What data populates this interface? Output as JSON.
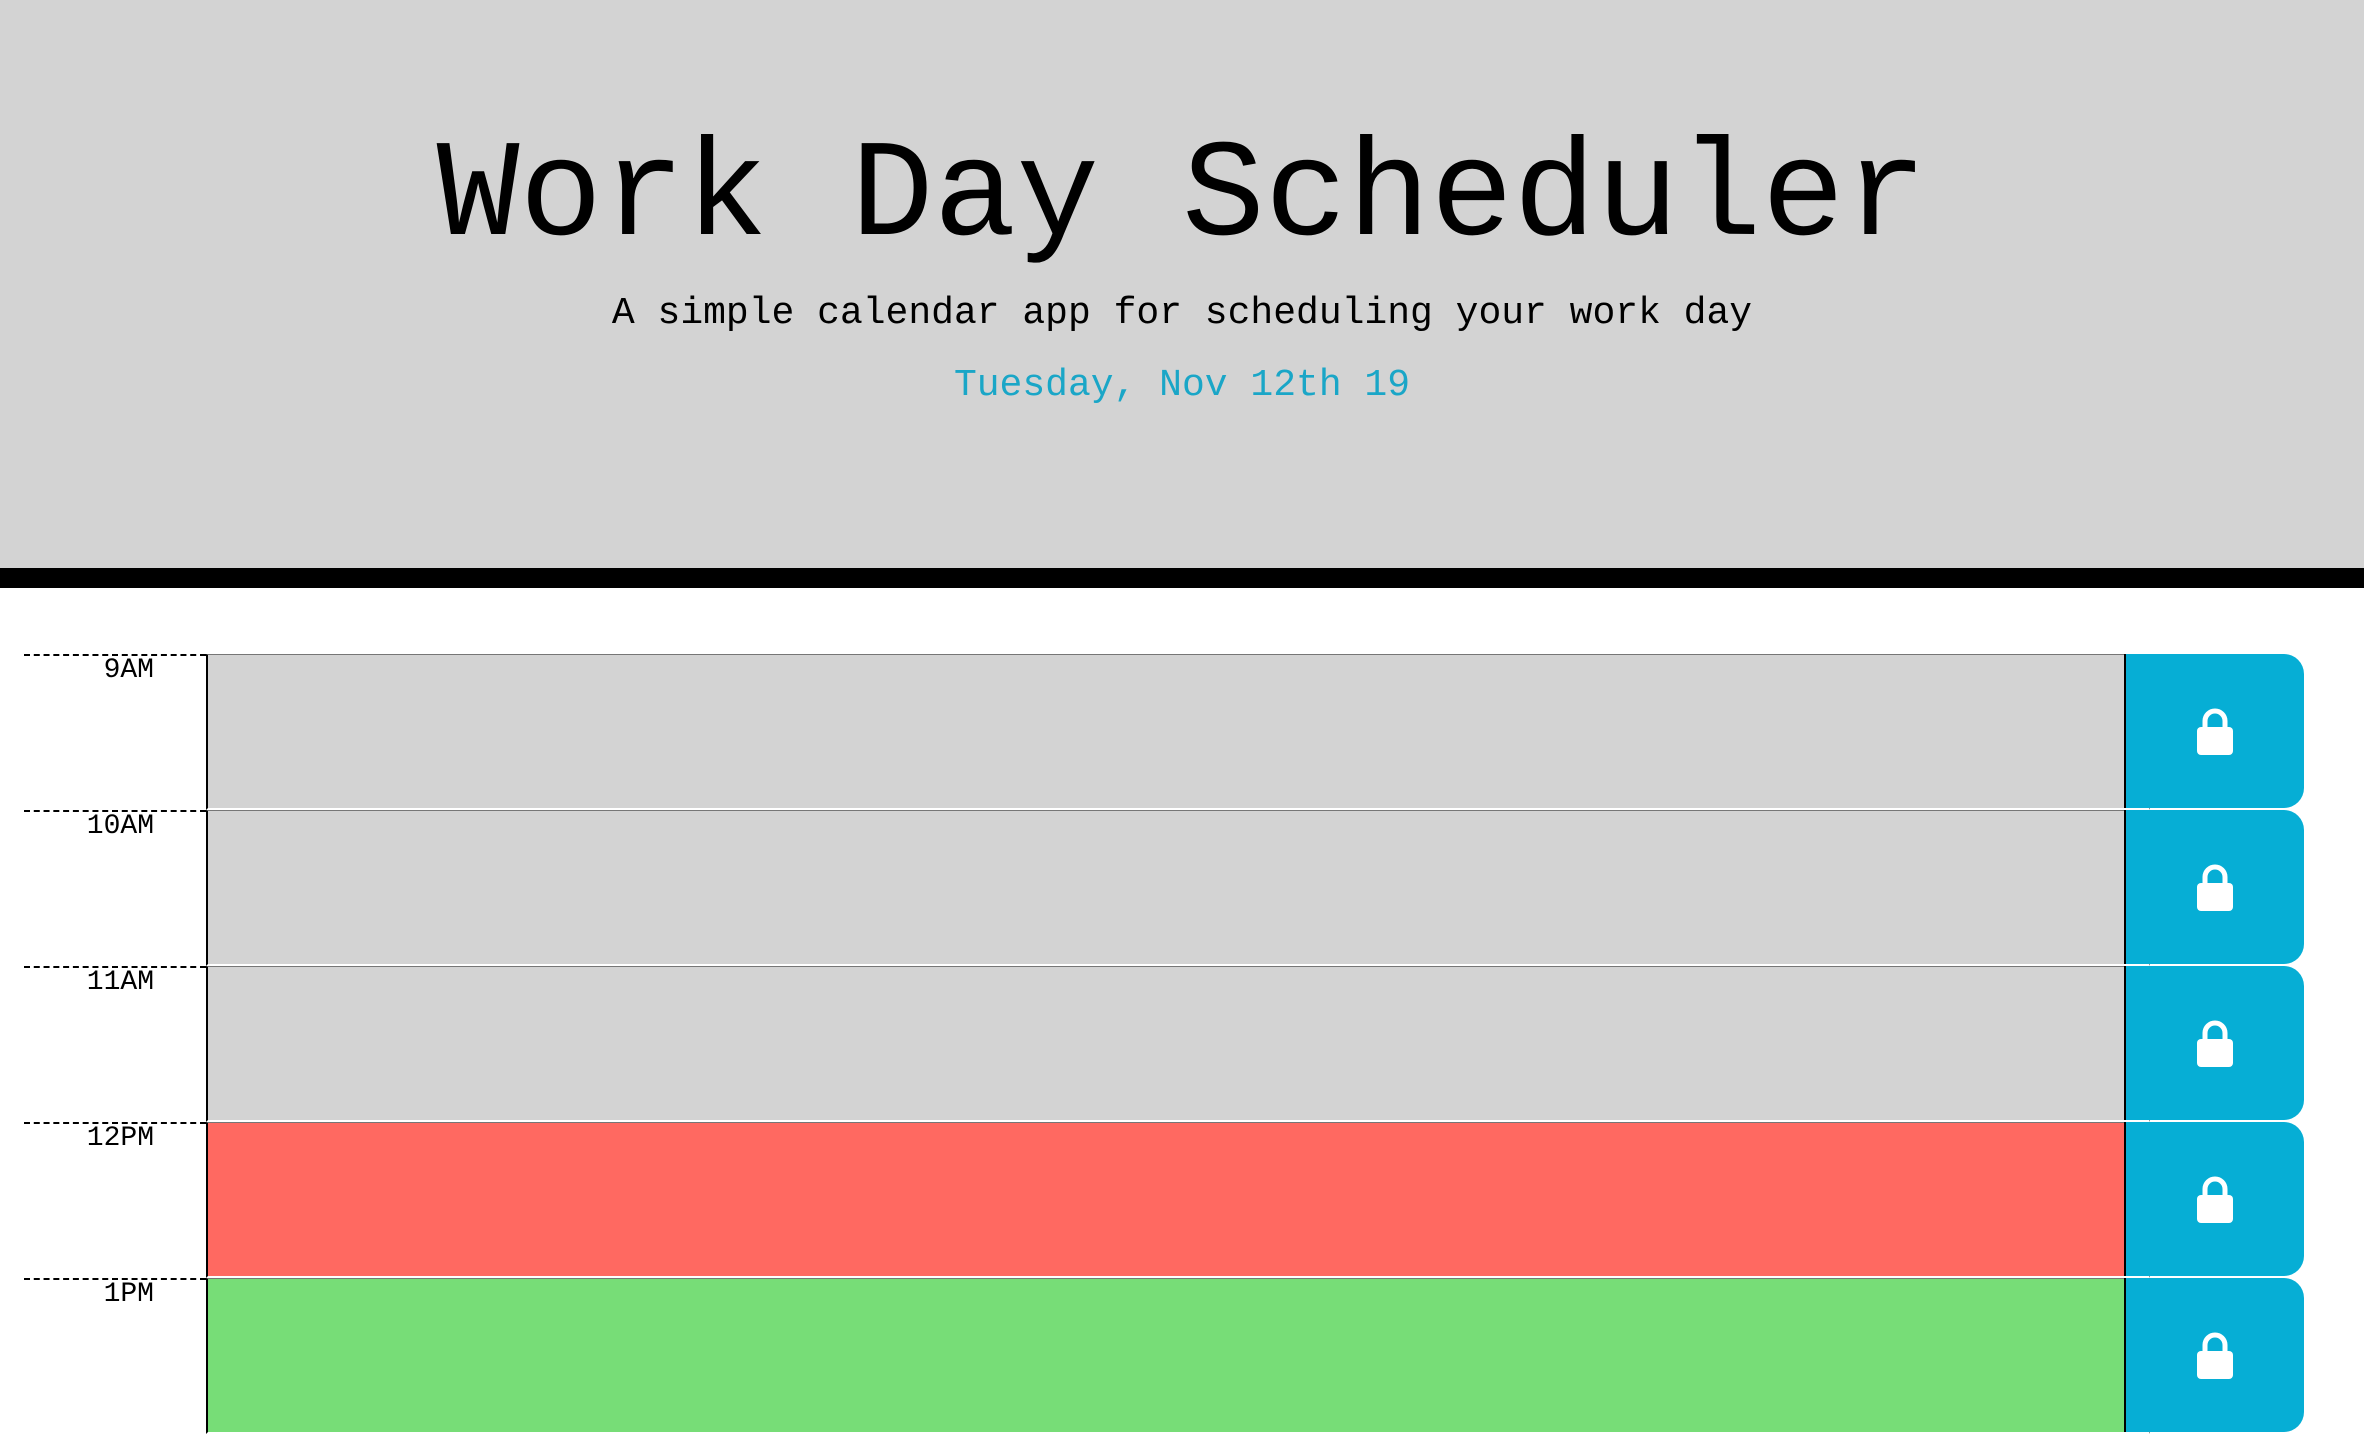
{
  "header": {
    "title": "Work Day Scheduler",
    "subtitle": "A simple calendar app for scheduling your work day",
    "current_day": "Tuesday, Nov 12th 19"
  },
  "colors": {
    "header_bg": "#d3d3d3",
    "past": "#d3d3d3",
    "present": "#ff6961",
    "future": "#77dd77",
    "save_button": "#06aed5",
    "date_text": "#1aa6c7"
  },
  "time_blocks": [
    {
      "hour": "9AM",
      "state": "past",
      "text": "",
      "icon": "lock-icon"
    },
    {
      "hour": "10AM",
      "state": "past",
      "text": "",
      "icon": "lock-icon"
    },
    {
      "hour": "11AM",
      "state": "past",
      "text": "",
      "icon": "lock-icon"
    },
    {
      "hour": "12PM",
      "state": "present",
      "text": "",
      "icon": "lock-icon"
    },
    {
      "hour": "1PM",
      "state": "future",
      "text": "",
      "icon": "lock-icon"
    }
  ]
}
